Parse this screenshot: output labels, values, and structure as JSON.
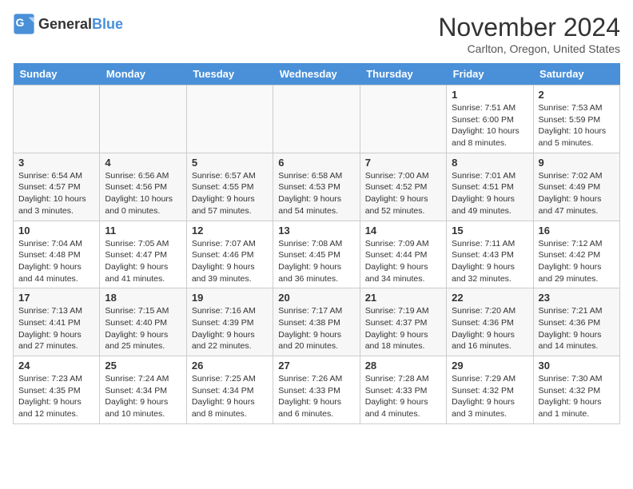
{
  "logo": {
    "text_general": "General",
    "text_blue": "Blue"
  },
  "title": "November 2024",
  "location": "Carlton, Oregon, United States",
  "weekdays": [
    "Sunday",
    "Monday",
    "Tuesday",
    "Wednesday",
    "Thursday",
    "Friday",
    "Saturday"
  ],
  "weeks": [
    [
      {
        "day": "",
        "info": ""
      },
      {
        "day": "",
        "info": ""
      },
      {
        "day": "",
        "info": ""
      },
      {
        "day": "",
        "info": ""
      },
      {
        "day": "",
        "info": ""
      },
      {
        "day": "1",
        "info": "Sunrise: 7:51 AM\nSunset: 6:00 PM\nDaylight: 10 hours\nand 8 minutes."
      },
      {
        "day": "2",
        "info": "Sunrise: 7:53 AM\nSunset: 5:59 PM\nDaylight: 10 hours\nand 5 minutes."
      }
    ],
    [
      {
        "day": "3",
        "info": "Sunrise: 6:54 AM\nSunset: 4:57 PM\nDaylight: 10 hours\nand 3 minutes."
      },
      {
        "day": "4",
        "info": "Sunrise: 6:56 AM\nSunset: 4:56 PM\nDaylight: 10 hours\nand 0 minutes."
      },
      {
        "day": "5",
        "info": "Sunrise: 6:57 AM\nSunset: 4:55 PM\nDaylight: 9 hours\nand 57 minutes."
      },
      {
        "day": "6",
        "info": "Sunrise: 6:58 AM\nSunset: 4:53 PM\nDaylight: 9 hours\nand 54 minutes."
      },
      {
        "day": "7",
        "info": "Sunrise: 7:00 AM\nSunset: 4:52 PM\nDaylight: 9 hours\nand 52 minutes."
      },
      {
        "day": "8",
        "info": "Sunrise: 7:01 AM\nSunset: 4:51 PM\nDaylight: 9 hours\nand 49 minutes."
      },
      {
        "day": "9",
        "info": "Sunrise: 7:02 AM\nSunset: 4:49 PM\nDaylight: 9 hours\nand 47 minutes."
      }
    ],
    [
      {
        "day": "10",
        "info": "Sunrise: 7:04 AM\nSunset: 4:48 PM\nDaylight: 9 hours\nand 44 minutes."
      },
      {
        "day": "11",
        "info": "Sunrise: 7:05 AM\nSunset: 4:47 PM\nDaylight: 9 hours\nand 41 minutes."
      },
      {
        "day": "12",
        "info": "Sunrise: 7:07 AM\nSunset: 4:46 PM\nDaylight: 9 hours\nand 39 minutes."
      },
      {
        "day": "13",
        "info": "Sunrise: 7:08 AM\nSunset: 4:45 PM\nDaylight: 9 hours\nand 36 minutes."
      },
      {
        "day": "14",
        "info": "Sunrise: 7:09 AM\nSunset: 4:44 PM\nDaylight: 9 hours\nand 34 minutes."
      },
      {
        "day": "15",
        "info": "Sunrise: 7:11 AM\nSunset: 4:43 PM\nDaylight: 9 hours\nand 32 minutes."
      },
      {
        "day": "16",
        "info": "Sunrise: 7:12 AM\nSunset: 4:42 PM\nDaylight: 9 hours\nand 29 minutes."
      }
    ],
    [
      {
        "day": "17",
        "info": "Sunrise: 7:13 AM\nSunset: 4:41 PM\nDaylight: 9 hours\nand 27 minutes."
      },
      {
        "day": "18",
        "info": "Sunrise: 7:15 AM\nSunset: 4:40 PM\nDaylight: 9 hours\nand 25 minutes."
      },
      {
        "day": "19",
        "info": "Sunrise: 7:16 AM\nSunset: 4:39 PM\nDaylight: 9 hours\nand 22 minutes."
      },
      {
        "day": "20",
        "info": "Sunrise: 7:17 AM\nSunset: 4:38 PM\nDaylight: 9 hours\nand 20 minutes."
      },
      {
        "day": "21",
        "info": "Sunrise: 7:19 AM\nSunset: 4:37 PM\nDaylight: 9 hours\nand 18 minutes."
      },
      {
        "day": "22",
        "info": "Sunrise: 7:20 AM\nSunset: 4:36 PM\nDaylight: 9 hours\nand 16 minutes."
      },
      {
        "day": "23",
        "info": "Sunrise: 7:21 AM\nSunset: 4:36 PM\nDaylight: 9 hours\nand 14 minutes."
      }
    ],
    [
      {
        "day": "24",
        "info": "Sunrise: 7:23 AM\nSunset: 4:35 PM\nDaylight: 9 hours\nand 12 minutes."
      },
      {
        "day": "25",
        "info": "Sunrise: 7:24 AM\nSunset: 4:34 PM\nDaylight: 9 hours\nand 10 minutes."
      },
      {
        "day": "26",
        "info": "Sunrise: 7:25 AM\nSunset: 4:34 PM\nDaylight: 9 hours\nand 8 minutes."
      },
      {
        "day": "27",
        "info": "Sunrise: 7:26 AM\nSunset: 4:33 PM\nDaylight: 9 hours\nand 6 minutes."
      },
      {
        "day": "28",
        "info": "Sunrise: 7:28 AM\nSunset: 4:33 PM\nDaylight: 9 hours\nand 4 minutes."
      },
      {
        "day": "29",
        "info": "Sunrise: 7:29 AM\nSunset: 4:32 PM\nDaylight: 9 hours\nand 3 minutes."
      },
      {
        "day": "30",
        "info": "Sunrise: 7:30 AM\nSunset: 4:32 PM\nDaylight: 9 hours\nand 1 minute."
      }
    ]
  ]
}
